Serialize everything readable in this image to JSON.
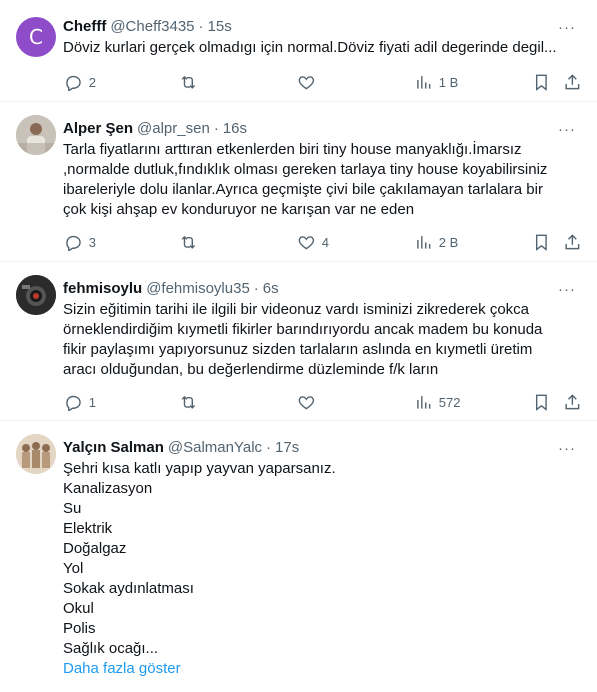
{
  "tweets": [
    {
      "avatar_letter": "C",
      "avatar_color": "#8e4cc9",
      "name": "Chefff",
      "handle": "@Cheff3435",
      "time": "15s",
      "lines": [
        "Döviz kurlari gerçek olmadıgı için normal.Döviz fiyati adil degerinde degil..."
      ],
      "replies": "2",
      "reposts": "",
      "likes": "",
      "views": "1 B"
    },
    {
      "name": "Alper Şen",
      "handle": "@alpr_sen",
      "time": "16s",
      "lines": [
        "Tarla fiyatlarını arttıran etkenlerden biri tiny house manyaklığı.İmarsız",
        ",normalde dutluk,fındıklık olması gereken tarlaya tiny house koyabilirsiniz",
        "ibareleriyle dolu ilanlar.Ayrıca geçmişte çivi bile çakılamayan tarlalara bir",
        "çok kişi ahşap ev konduruyor ne karışan var ne eden"
      ],
      "replies": "3",
      "reposts": "",
      "likes": "4",
      "views": "2 B"
    },
    {
      "name": "fehmisoylu",
      "handle": "@fehmisoylu35",
      "time": "6s",
      "lines": [
        "Sizin eğitimin tarihi ile ilgili bir videonuz vardı isminizi zikrederek çokca",
        "örneklendirdiğim kıymetli fikirler barındırıyordu ancak madem bu konuda",
        "fikir paylaşımı yapıyorsunuz sizden tarlaların aslında en kıymetli üretim",
        "aracı olduğundan, bu değerlendirme düzleminde f/k ların"
      ],
      "replies": "1",
      "reposts": "",
      "likes": "",
      "views": "572"
    },
    {
      "name": "Yalçın Salman",
      "handle": "@SalmanYalc",
      "time": "17s",
      "lines": [
        "Şehri kısa katlı yapıp yayvan yaparsanız.",
        "Kanalizasyon",
        "Su",
        "Elektrik",
        "Doğalgaz",
        "Yol",
        "Sokak aydınlatması",
        "Okul",
        "Polis",
        "Sağlık ocağı..."
      ],
      "show_more": "Daha fazla göster"
    }
  ],
  "more_glyph": "···"
}
